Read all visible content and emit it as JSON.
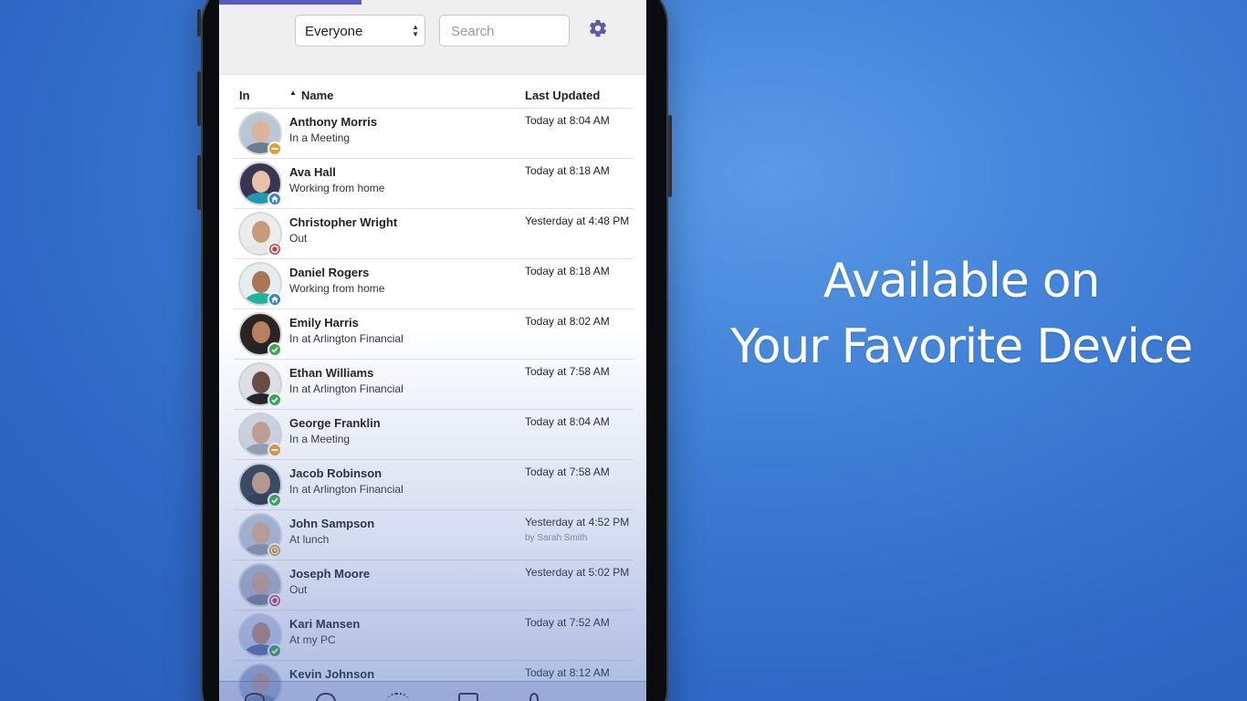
{
  "headline": {
    "line1": "Available on",
    "line2": "Your Favorite Device"
  },
  "toolbar": {
    "filter_value": "Everyone",
    "search_placeholder": "Search",
    "accent_color": "#5b59c2"
  },
  "columns": {
    "in": "In",
    "name": "Name",
    "last_updated": "Last Updated"
  },
  "people": [
    {
      "name": "Anthony Morris",
      "status": "In a Meeting",
      "updated": "Today at 8:04 AM",
      "badge": "busy",
      "badge_color": "#e0a030",
      "skin": "#d9b49a",
      "shirt": "#6b7f92",
      "bg": "#b8c7d6"
    },
    {
      "name": "Ava Hall",
      "status": "Working from home",
      "updated": "Today at 8:18 AM",
      "badge": "home",
      "badge_color": "#2f80d8",
      "skin": "#e8c2a8",
      "shirt": "#1f9bb0",
      "bg": "#3a3550"
    },
    {
      "name": "Christopher Wright",
      "status": "Out",
      "updated": "Yesterday at 4:48 PM",
      "badge": "out",
      "badge_color": "#d23a3a",
      "skin": "#c89a7a",
      "shirt": "#e8e8e8",
      "bg": "#ececec"
    },
    {
      "name": "Daniel Rogers",
      "status": "Working from home",
      "updated": "Today at 8:18 AM",
      "badge": "home",
      "badge_color": "#2f80d8",
      "skin": "#a97552",
      "shirt": "#1fb2a0",
      "bg": "#e4eeee"
    },
    {
      "name": "Emily Harris",
      "status": "In at Arlington Financial",
      "updated": "Today at 8:02 AM",
      "badge": "in",
      "badge_color": "#3aa84a",
      "skin": "#b78060",
      "shirt": "#222222",
      "bg": "#2a2422"
    },
    {
      "name": "Ethan Williams",
      "status": "In at Arlington Financial",
      "updated": "Today at 7:58 AM",
      "badge": "in",
      "badge_color": "#3aa84a",
      "skin": "#6a4a38",
      "shirt": "#1d1d1d",
      "bg": "#e6e6e6"
    },
    {
      "name": "George Franklin",
      "status": "In a Meeting",
      "updated": "Today at 8:04 AM",
      "badge": "busy",
      "badge_color": "#e0a030",
      "skin": "#caa38a",
      "shirt": "#9aa4ad",
      "bg": "#d9dde2"
    },
    {
      "name": "Jacob Robinson",
      "status": "In at Arlington Financial",
      "updated": "Today at 7:58 AM",
      "badge": "in",
      "badge_color": "#3aa84a",
      "skin": "#c8a087",
      "shirt": "#2b3440",
      "bg": "#33404d"
    },
    {
      "name": "John Sampson",
      "status": "At lunch",
      "updated": "Yesterday at 4:52 PM",
      "by": "by Sarah Smith",
      "badge": "lunch",
      "badge_color": "#c9952e",
      "skin": "#d2a88a",
      "shirt": "#8b96a8",
      "bg": "#b7c2d0"
    },
    {
      "name": "Joseph Moore",
      "status": "Out",
      "updated": "Yesterday at 5:02 PM",
      "badge": "out",
      "badge_color": "#c4355a",
      "skin": "#caa08a",
      "shirt": "#7a7f8c",
      "bg": "#aab3c3"
    },
    {
      "name": "Kari Mansen",
      "status": "At my PC",
      "updated": "Today at 7:52 AM",
      "badge": "in",
      "badge_color": "#3aa84a",
      "skin": "#b9886c",
      "shirt": "#5c6aa5",
      "bg": "#c8cfe4"
    },
    {
      "name": "Kevin Johnson",
      "status": "",
      "updated": "Today at 8:12 AM",
      "badge": "none",
      "badge_color": "#3aa84a",
      "skin": "#c79d82",
      "shirt": "#6b7b96",
      "bg": "#a8b4cc"
    }
  ]
}
